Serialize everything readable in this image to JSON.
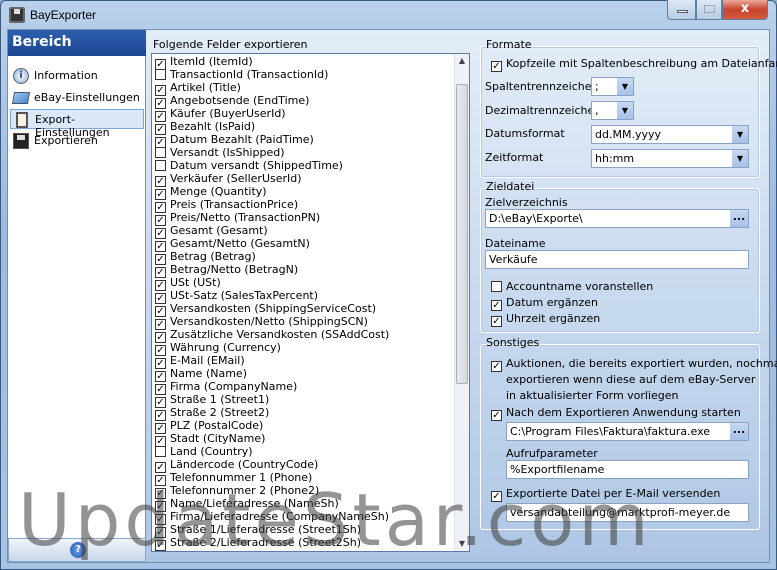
{
  "window": {
    "title": "BayExporter",
    "close_label": "x"
  },
  "sidebar": {
    "header": "Bereich",
    "items": [
      {
        "label": "Information",
        "icon": "info-icon"
      },
      {
        "label": "eBay-Einstellungen",
        "icon": "ebay-settings-icon"
      },
      {
        "label": "Export-Einstellungen",
        "icon": "clipboard-icon",
        "selected": true
      },
      {
        "label": "Exportieren",
        "icon": "floppy-disk-icon"
      }
    ],
    "help_label": "?"
  },
  "fields": {
    "label": "Folgende Felder exportieren",
    "items": [
      {
        "label": "ItemId (ItemId)",
        "checked": true
      },
      {
        "label": "TransactionId (TransactionId)",
        "checked": false
      },
      {
        "label": "Artikel (Title)",
        "checked": true
      },
      {
        "label": "Angebotsende (EndTime)",
        "checked": true
      },
      {
        "label": "Käufer (BuyerUserId)",
        "checked": true
      },
      {
        "label": "Bezahlt (IsPaid)",
        "checked": true
      },
      {
        "label": "Datum Bezahlt (PaidTime)",
        "checked": true
      },
      {
        "label": "Versandt (IsShipped)",
        "checked": false
      },
      {
        "label": "Datum versandt (ShippedTime)",
        "checked": false
      },
      {
        "label": "Verkäufer (SellerUserId)",
        "checked": true
      },
      {
        "label": "Menge (Quantity)",
        "checked": true
      },
      {
        "label": "Preis (TransactionPrice)",
        "checked": true
      },
      {
        "label": "Preis/Netto (TransactionPN)",
        "checked": true
      },
      {
        "label": "Gesamt (Gesamt)",
        "checked": true
      },
      {
        "label": "Gesamt/Netto (GesamtN)",
        "checked": true
      },
      {
        "label": "Betrag (Betrag)",
        "checked": true
      },
      {
        "label": "Betrag/Netto (BetragN)",
        "checked": true
      },
      {
        "label": "USt (USt)",
        "checked": true
      },
      {
        "label": "USt-Satz (SalesTaxPercent)",
        "checked": true
      },
      {
        "label": "Versandkosten (ShippingServiceCost)",
        "checked": true
      },
      {
        "label": "Versandkosten/Netto (ShippingSCN)",
        "checked": true
      },
      {
        "label": "Zusätzliche Versandkosten (SSAddCost)",
        "checked": true
      },
      {
        "label": "Währung (Currency)",
        "checked": true
      },
      {
        "label": "E-Mail (EMail)",
        "checked": true
      },
      {
        "label": "Name (Name)",
        "checked": true
      },
      {
        "label": "Firma (CompanyName)",
        "checked": true
      },
      {
        "label": "Straße 1 (Street1)",
        "checked": true
      },
      {
        "label": "Straße 2 (Street2)",
        "checked": true
      },
      {
        "label": "PLZ (PostalCode)",
        "checked": true
      },
      {
        "label": "Stadt (CityName)",
        "checked": true
      },
      {
        "label": "Land (Country)",
        "checked": false
      },
      {
        "label": "Ländercode (CountryCode)",
        "checked": true
      },
      {
        "label": "Telefonnummer 1 (Phone)",
        "checked": true
      },
      {
        "label": "Telefonnummer 2 (Phone2)",
        "checked": true
      },
      {
        "label": "Name/Lieferadresse (NameSh)",
        "checked": true
      },
      {
        "label": "Firma/Lieferadresse (CompanyNameSh)",
        "checked": true
      },
      {
        "label": "Straße 1/Lieferadresse (Street1Sh)",
        "checked": true
      },
      {
        "label": "Straße 2/Lieferadresse (Street2Sh)",
        "checked": true
      }
    ]
  },
  "formate": {
    "title": "Formate",
    "header_row_label": "Kopfzeile mit Spaltenbeschreibung am Dateianfang",
    "header_row_checked": true,
    "column_sep_label": "Spaltentrennzeichen",
    "column_sep_value": ";",
    "decimal_sep_label": "Dezimaltrennzeichen",
    "decimal_sep_value": ",",
    "date_format_label": "Datumsformat",
    "date_format_value": "dd.MM.yyyy",
    "time_format_label": "Zeitformat",
    "time_format_value": "hh:mm"
  },
  "zieldatei": {
    "title": "Zieldatei",
    "dir_label": "Zielverzeichnis",
    "dir_value": "D:\\eBay\\Exporte\\",
    "filename_label": "Dateiname",
    "filename_value": "Verkäufe",
    "opt_account": "Accountname voranstellen",
    "opt_account_checked": false,
    "opt_date": "Datum ergänzen",
    "opt_date_checked": true,
    "opt_time": "Uhrzeit ergänzen",
    "opt_time_checked": true,
    "browse_label": "..."
  },
  "sonstiges": {
    "title": "Sonstiges",
    "reexport_line1": "Auktionen, die bereits exportiert wurden, nochmal",
    "reexport_line2": "exportieren wenn diese auf dem eBay-Server",
    "reexport_line3": "in aktualisierter Form vorliegen",
    "reexport_checked": true,
    "launch_label": "Nach dem Exportieren Anwendung starten",
    "launch_checked": true,
    "app_path": "C:\\Program Files\\Faktura\\faktura.exe",
    "params_label": "Aufrufparameter",
    "params_value": "%Exportfilename",
    "email_label": "Exportierte Datei per E-Mail versenden",
    "email_checked": true,
    "email_value": "versandabteilung@marktprofi-meyer.de"
  },
  "watermark": "UpdateStar.com"
}
